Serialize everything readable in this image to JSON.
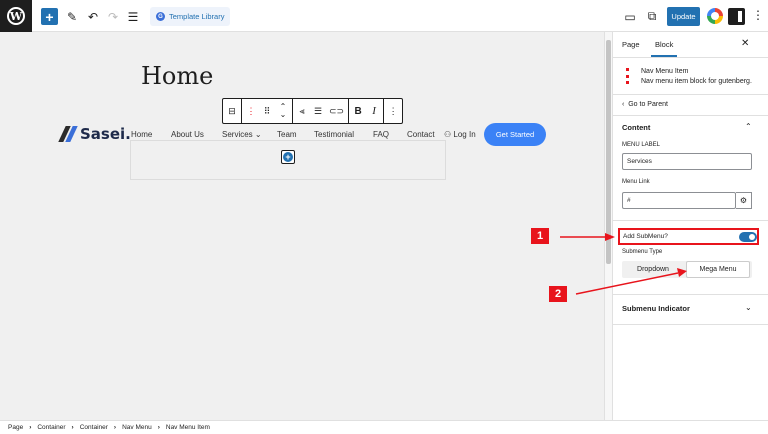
{
  "toolbar": {
    "template_library_label": "Template Library",
    "update_label": "Update"
  },
  "canvas": {
    "page_title": "Home",
    "logo_text": "Sasei.",
    "nav_items": [
      "Home",
      "About Us",
      "Services",
      "Team",
      "Testimonial",
      "FAQ",
      "Contact"
    ],
    "login_label": "Log In",
    "cta_label": "Get Started"
  },
  "annotations": {
    "badge_1": "1",
    "badge_2": "2"
  },
  "sidebar": {
    "tab_page": "Page",
    "tab_block": "Block",
    "block_title": "Nav Menu Item",
    "block_desc": "Nav menu item block for gutenberg.",
    "go_to_parent": "Go to Parent",
    "content_heading": "Content",
    "menu_label_heading": "MENU LABEL",
    "menu_label_value": "Services",
    "menu_link_heading": "Menu Link",
    "menu_link_value": "#",
    "add_submenu_label": "Add SubMenu?",
    "add_submenu_on": true,
    "submenu_type_heading": "Submenu Type",
    "submenu_options": [
      "Dropdown",
      "Mega Menu"
    ],
    "submenu_selected": "Mega Menu",
    "submenu_indicator_heading": "Submenu Indicator"
  },
  "breadcrumb": [
    "Page",
    "Container",
    "Container",
    "Nav Menu",
    "Nav Menu Item"
  ],
  "colors": {
    "accent": "#2271b1",
    "annotation_red": "#e8141c",
    "cta_blue": "#3b82f6"
  }
}
